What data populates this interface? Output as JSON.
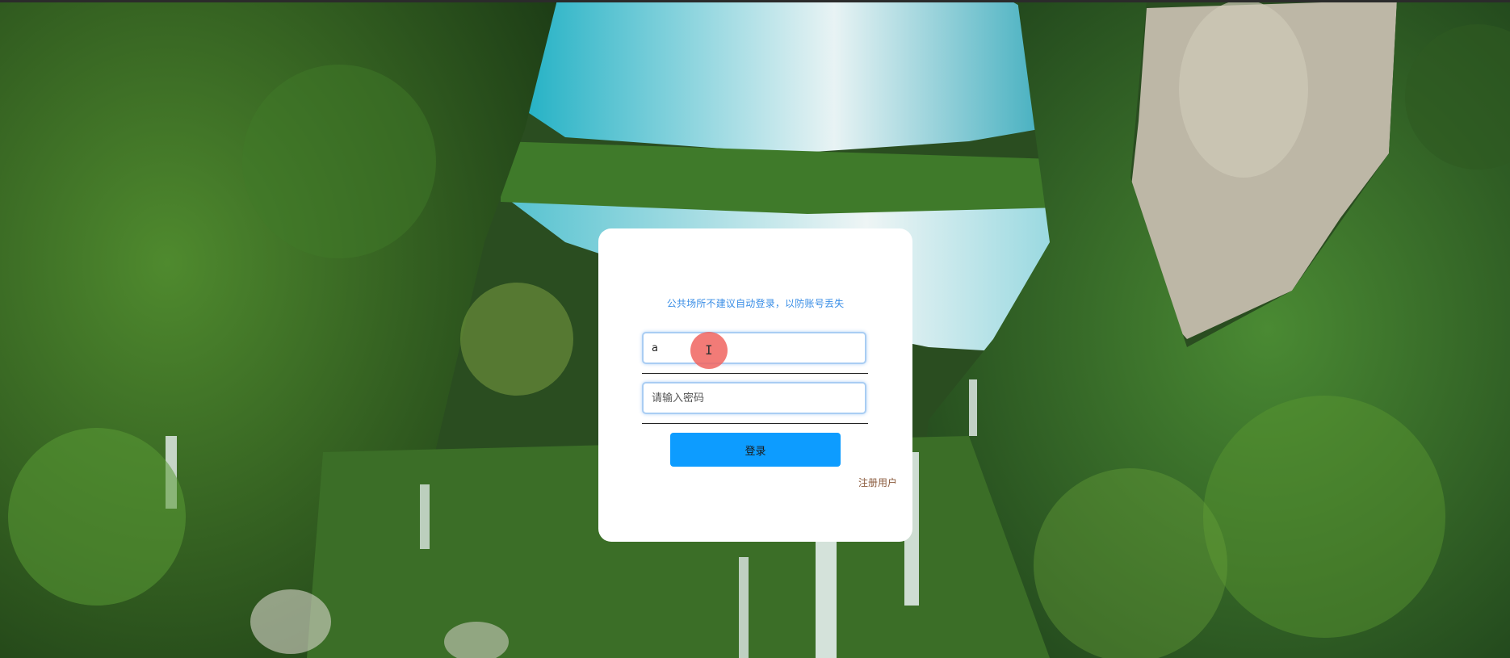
{
  "login": {
    "hint": "公共场所不建议自动登录，以防账号丢失",
    "username_value": "a",
    "password_placeholder": "请输入密码",
    "login_button_label": "登录",
    "register_link_label": "注册用户"
  },
  "colors": {
    "accent_button": "#0d9cff",
    "hint_text": "#3a8ee6",
    "register_link": "#8a5a3c",
    "card_background": "#ffffff",
    "cursor_marker": "#f0645f"
  },
  "icons": {
    "cursor": "text-cursor-icon"
  }
}
